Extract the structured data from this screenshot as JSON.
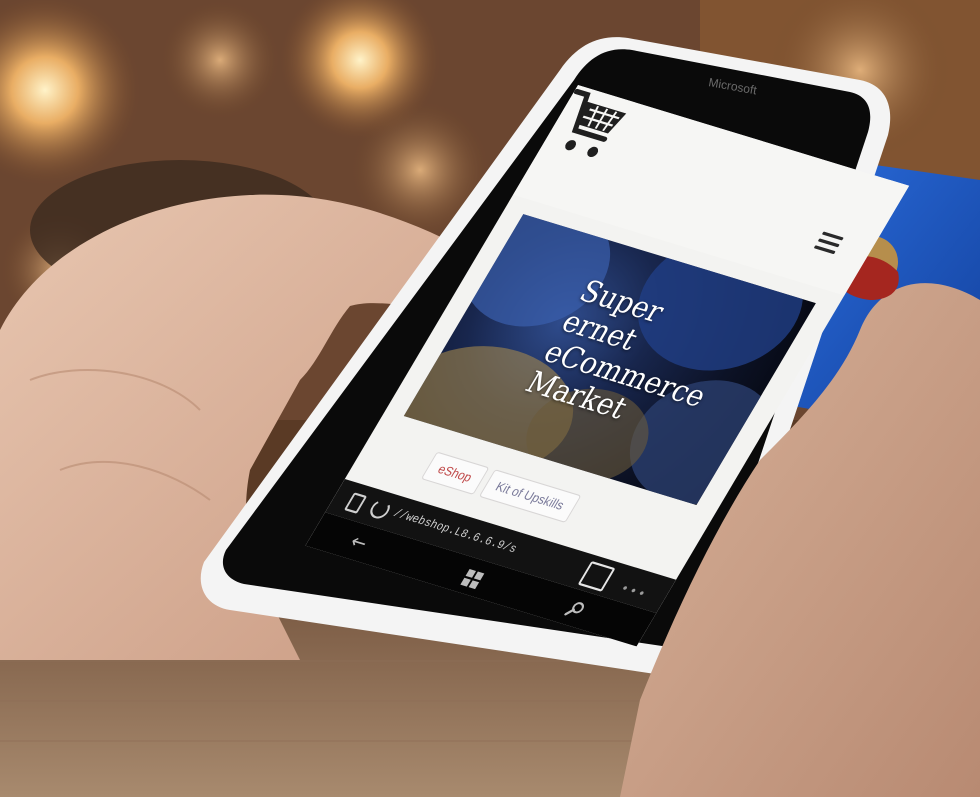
{
  "phone": {
    "brand": "Microsoft"
  },
  "site": {
    "header": {
      "cart_icon": "shopping-cart-icon",
      "menu_icon": "hamburger-menu-icon"
    },
    "hero": {
      "title_lines": [
        "Super",
        "ernet",
        "eCommerce",
        "Market"
      ]
    },
    "pills": [
      "eShop",
      "Kit of Upskills"
    ]
  },
  "browser": {
    "url": "//webshop.L8.6.6.9/s",
    "icons": {
      "page": "page-icon",
      "reload": "reload-icon",
      "tabs": "tabs-icon",
      "more": "more-icon",
      "back": "back-arrow-icon",
      "start": "windows-logo-icon",
      "search": "search-icon"
    }
  },
  "scene": {
    "card_color": "#1b57c2",
    "phone_color": "#f4f4f4",
    "nail_color": "#a5261f"
  }
}
